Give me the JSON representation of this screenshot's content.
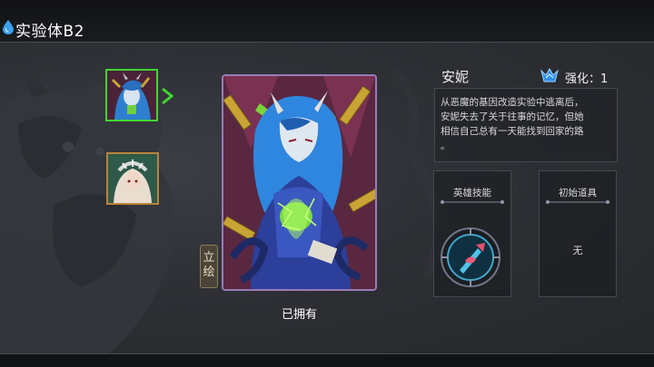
{
  "header": {
    "title": "实验体B2"
  },
  "hero": {
    "name": "安妮",
    "enhance_label": "强化：1",
    "description": "从恶魔的基因改造实验中逃离后，\n安妮失去了关于往事的记忆，但她\n相信自己总有一天能找到回家的路\n。",
    "owned_label": "已拥有"
  },
  "buttons": {
    "lihui": "立\n绘"
  },
  "panels": {
    "skill_title": "英雄技能",
    "item_title": "初始道具",
    "item_value": "无"
  },
  "colors": {
    "selected_border": "#41d534",
    "other_border": "#b8843a",
    "card_border": "#9a7bb8",
    "accent_blue": "#3aa0e8"
  }
}
